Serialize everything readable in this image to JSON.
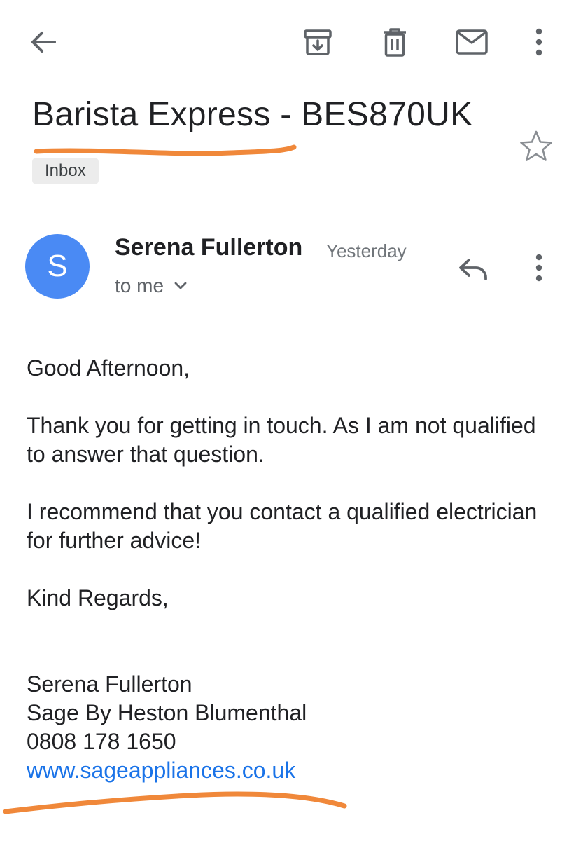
{
  "toolbar": {
    "back_icon": "arrow-back-icon",
    "archive_icon": "archive-icon",
    "delete_icon": "trash-icon",
    "mark_unread_icon": "mail-icon",
    "more_icon": "more-vert-icon"
  },
  "email": {
    "subject": "Barista Express - BES870UK",
    "label": "Inbox",
    "star_icon": "star-outline-icon"
  },
  "message": {
    "avatar_letter": "S",
    "avatar_color": "#4a8af4",
    "sender": "Serena Fullerton",
    "time": "Yesterday",
    "recipient": "to me",
    "reply_icon": "reply-icon",
    "more_icon": "more-vert-icon",
    "greeting": "Good Afternoon,",
    "paragraphs": [
      "Thank you for getting in touch. As I am not qualified to answer that question.",
      "I recommend that you contact a qualified electrician for further advice!"
    ],
    "closing": "Kind Regards,",
    "signature": {
      "name": "Serena Fullerton",
      "company": "Sage By Heston Blumenthal",
      "phone": "0808 178 1650",
      "website": "www.sageappliances.co.uk"
    }
  },
  "colors": {
    "link": "#1a73e8",
    "annotation": "#f0883a",
    "icon": "#5f6368"
  }
}
